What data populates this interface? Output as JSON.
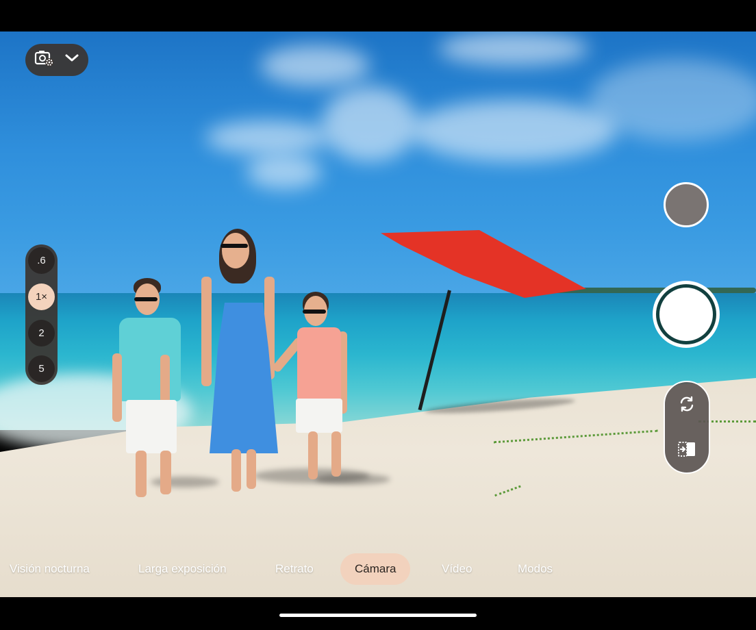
{
  "top_controls": {
    "settings_icon": "camera-settings-icon",
    "chevron_icon": "chevron-down-icon"
  },
  "zoom": {
    "levels": [
      ".6",
      "1×",
      "2",
      "5"
    ],
    "active_index": 1
  },
  "right_controls": {
    "thumbnail_icon": "gallery-thumbnail",
    "shutter_icon": "shutter-button",
    "switch_camera_icon": "switch-camera-icon",
    "lens_toggle_icon": "dual-screen-icon"
  },
  "modes": {
    "items": [
      "Visión nocturna",
      "Larga exposición",
      "Retrato",
      "Cámara",
      "Vídeo",
      "Modos"
    ],
    "active": "Cámara"
  },
  "colors": {
    "active_mode_bg": "#f2d2bd",
    "active_zoom_bg": "#f4d3bd",
    "shutter_ring": "#12403f"
  }
}
